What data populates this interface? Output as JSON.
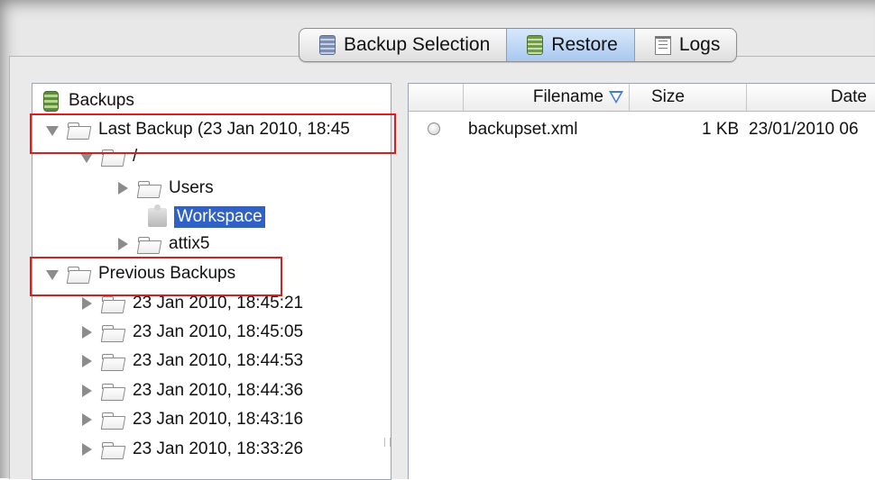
{
  "tabs": [
    {
      "label": "Backup Selection",
      "icon": "database-icon",
      "active": false
    },
    {
      "label": "Restore",
      "icon": "database-icon",
      "active": true
    },
    {
      "label": "Logs",
      "icon": "logs-icon",
      "active": false
    }
  ],
  "tree": {
    "root": "Backups",
    "last_backup": "Last Backup (23 Jan 2010, 18:45",
    "slash": "/",
    "users": "Users",
    "workspace": "Workspace",
    "attix5": "attix5",
    "previous_backups": "Previous Backups",
    "previous_items": [
      "23 Jan 2010, 18:45:21",
      "23 Jan 2010, 18:45:05",
      "23 Jan 2010, 18:44:53",
      "23 Jan 2010, 18:44:36",
      "23 Jan 2010, 18:43:16",
      "23 Jan 2010, 18:33:26"
    ]
  },
  "files": {
    "columns": {
      "filename": "Filename",
      "size": "Size",
      "date": "Date"
    },
    "rows": [
      {
        "filename": "backupset.xml",
        "size": "1 KB",
        "date": "23/01/2010 06"
      }
    ]
  },
  "colors": {
    "accent": "#2f61c6",
    "highlight_box": "#e01b1b"
  }
}
